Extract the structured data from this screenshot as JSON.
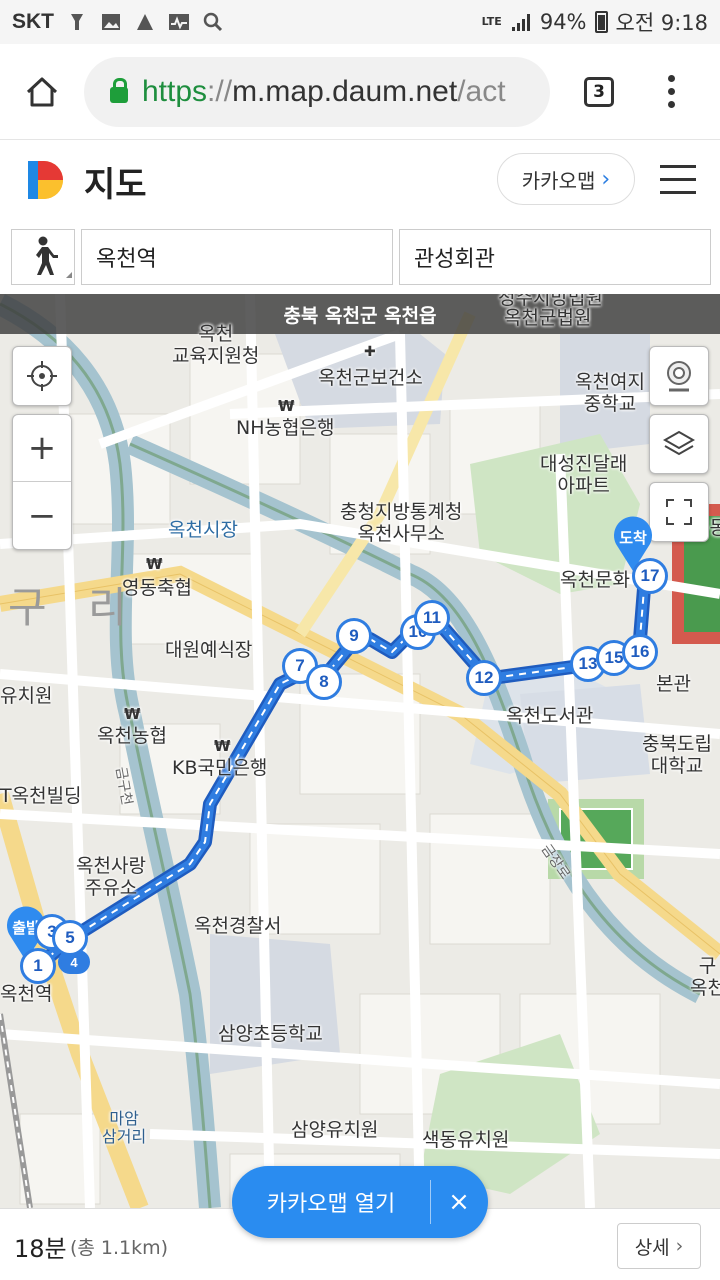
{
  "status_bar": {
    "carrier": "SKT",
    "network": "LTE",
    "battery": "94%",
    "time": "오전 9:18"
  },
  "browser": {
    "url_scheme": "https",
    "url_sep": "://",
    "url_host": "m.map.daum.net",
    "url_path": "/act",
    "tab_count": "3"
  },
  "header": {
    "title": "지도",
    "kakao_button": "카카오맵",
    "brand_colors": [
      "#1e88e5",
      "#f9a825",
      "#e53935",
      "#43a047"
    ]
  },
  "search": {
    "mode_icon": "walking-icon",
    "origin": "옥천역",
    "destination": "관성회관"
  },
  "map": {
    "region": "충북 옥천군 옥천읍",
    "route_color": "#2f7de1",
    "start_label": "출발",
    "end_label": "도착",
    "labels": {
      "court": "옥천군법원",
      "court_top": "청주지방법원",
      "edu_office": "옥천\n교육지원청",
      "health_center": "옥천군보건소",
      "nh_bank": "NH농협은행",
      "girls_school": "옥천여지\n중학교",
      "apartment": "대성진달래\n아파트",
      "stats_office": "충청지방통계청\n옥천사무소",
      "market": "옥천시장",
      "yeongdong": "영동축협",
      "guri": "구 리",
      "culture": "옥천문화",
      "wedding": "대원예식장",
      "kindergarten_left": "유치원",
      "okcheon_nh": "옥천농협",
      "kb_bank": "KB국민은행",
      "library": "옥천도서관",
      "main_hall": "본관",
      "chungbuk_univ": "충북도립\n대학교",
      "building": "T옥천빌딩",
      "gas_station": "옥천사랑\n주유소",
      "police": "옥천경찰서",
      "station": "옥천역",
      "samyang_school": "삼양초등학교",
      "mawam": "마암\n삼거리",
      "samyang_kinder": "삼양유치원",
      "saekdong_kinder": "색동유치원",
      "stream_road": "금구천",
      "stadium_road": "금장로",
      "right_edge": "구\n옥천",
      "right_edge2": "운동"
    },
    "waypoints": [
      "1",
      "3",
      "4",
      "5",
      "7",
      "8",
      "9",
      "10",
      "11",
      "12",
      "13",
      "15",
      "16",
      "17"
    ],
    "controls": {
      "my_location": "crosshair-icon",
      "zoom_in": "+",
      "zoom_out": "−",
      "roadview": "roadview-icon",
      "layers": "layers-icon",
      "fullscreen": "fullscreen-icon"
    }
  },
  "bottom": {
    "duration": "18분",
    "distance": "(총 1.1km)",
    "detail_button": "상세",
    "open_app_button": "카카오맵 열기",
    "close": "×"
  }
}
